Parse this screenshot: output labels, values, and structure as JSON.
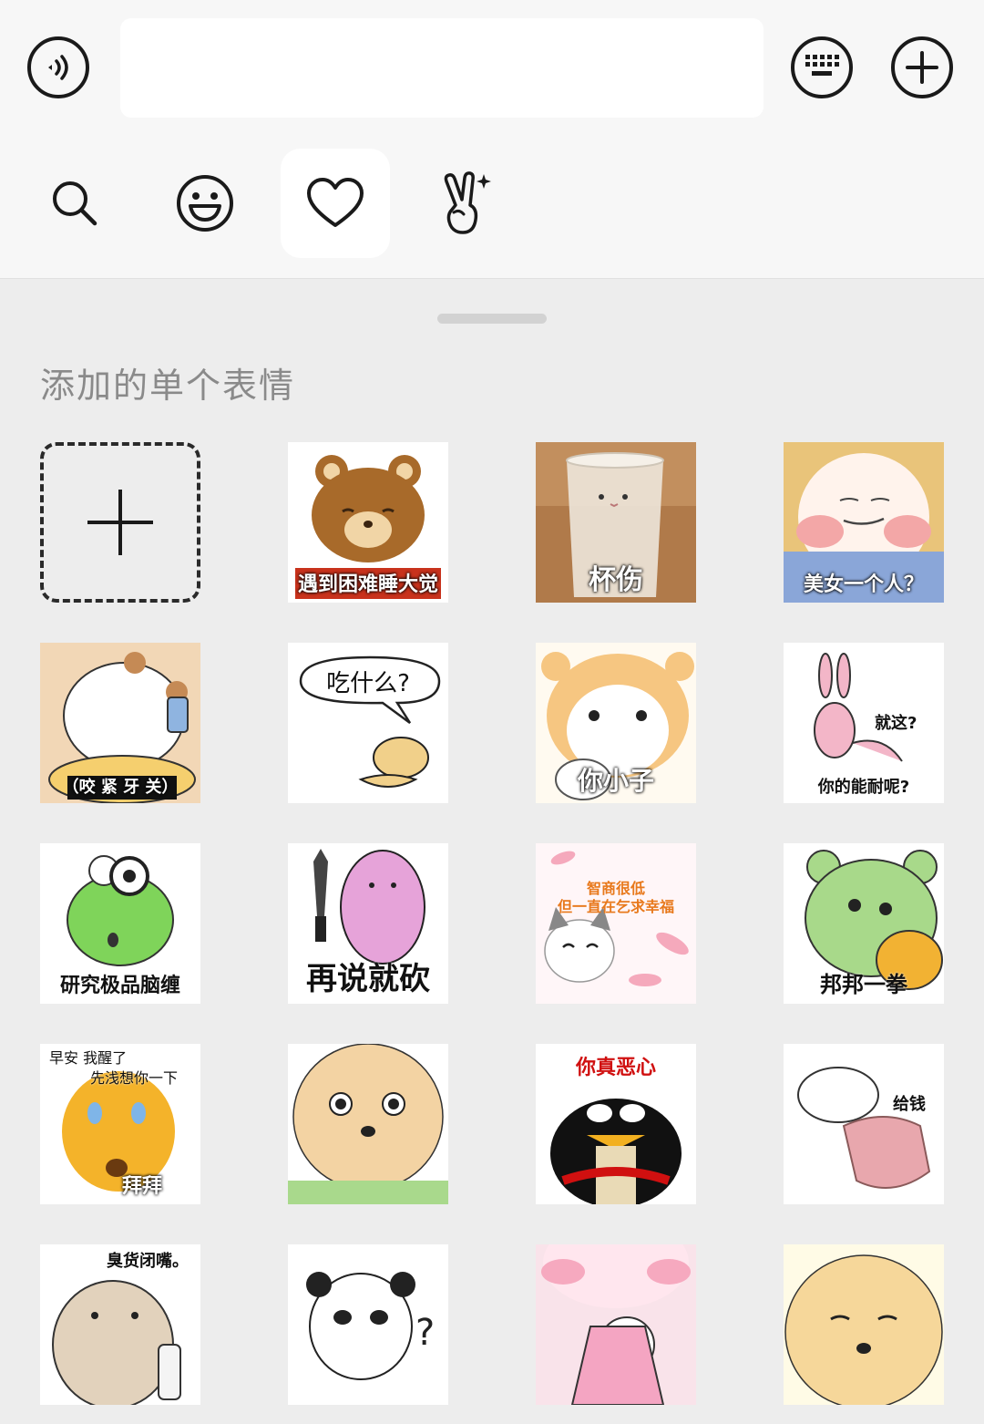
{
  "input_bar": {
    "voice_icon": "voice-icon",
    "text_value": "",
    "keyboard_icon": "keyboard-icon",
    "plus_icon": "plus-icon"
  },
  "tabs": [
    {
      "name": "search",
      "icon": "search-icon",
      "active": false
    },
    {
      "name": "emoji",
      "icon": "smiley-icon",
      "active": false
    },
    {
      "name": "favorites",
      "icon": "heart-icon",
      "active": true
    },
    {
      "name": "gestures",
      "icon": "victory-hand-icon",
      "active": false
    }
  ],
  "panel": {
    "section_title": "添加的单个表情"
  },
  "stickers": [
    {
      "caption": "遇到困难睡大觉"
    },
    {
      "caption": "杯伤"
    },
    {
      "caption": "美女一个人？"
    },
    {
      "caption": "（咬 紧 牙 关）"
    },
    {
      "caption": "吃什么?"
    },
    {
      "caption": "你小子"
    },
    {
      "caption": "就这?",
      "caption2": "你的能耐呢?"
    },
    {
      "caption": "研究极品脑缠"
    },
    {
      "caption": "再说就砍"
    },
    {
      "caption": "智商很低",
      "caption2": "但一直在乞求幸福"
    },
    {
      "caption": "邦邦一拳"
    },
    {
      "caption": "早安 我醒了",
      "caption2": "先浅想你一下",
      "caption3": "拜拜"
    },
    {
      "caption": ""
    },
    {
      "caption": "你真恶心"
    },
    {
      "caption": "给钱"
    },
    {
      "caption": "臭货闭嘴。"
    },
    {
      "caption": ""
    },
    {
      "caption": ""
    },
    {
      "caption": ""
    }
  ],
  "colors": {
    "top_bg": "#f7f7f7",
    "panel_bg": "#ededed",
    "icon_stroke": "#1a1a1a"
  }
}
